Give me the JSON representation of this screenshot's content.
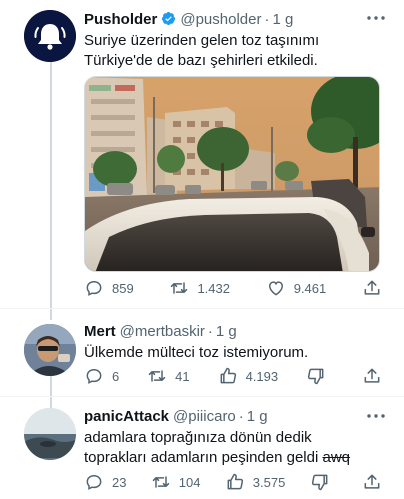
{
  "tweets": [
    {
      "name": "Pusholder",
      "handle": "@pusholder",
      "dot": "·",
      "time": "1 g",
      "text": "Suriye üzerinden gelen toz taşınımı\nTürkiye'de de bazı şehirleri etkiledi.",
      "replies": "859",
      "retweets": "1.432",
      "likes": "9.461"
    },
    {
      "name": "Mert",
      "handle": "@mertbaskir",
      "dot": "·",
      "time": "1 g",
      "text": "Ülkemde mülteci toz istemiyorum.",
      "replies": "6",
      "retweets": "41",
      "likes": "4.193"
    },
    {
      "name": "panicAttack",
      "handle": "@piiicaro",
      "dot": "·",
      "time": "1 g",
      "text_line1": "adamlara toprağınıza dönün dedik",
      "text_line2": "toprakları adamların peşinden geldi ",
      "text_struck": "awq",
      "replies": "23",
      "retweets": "104",
      "likes": "3.575"
    }
  ],
  "icons": {
    "reply": "reply-icon",
    "retweet": "retweet-icon",
    "like": "heart-icon",
    "thumbs_up": "thumbs-up-icon",
    "thumbs_down": "thumbs-down-icon",
    "share": "share-icon",
    "more": "more-icon",
    "verified": "verified-icon"
  },
  "colors": {
    "text": "#0f1419",
    "muted": "#536471",
    "verified": "#1d9bf0",
    "line": "#cfd9de",
    "brand_avatar": "#0b1640"
  }
}
